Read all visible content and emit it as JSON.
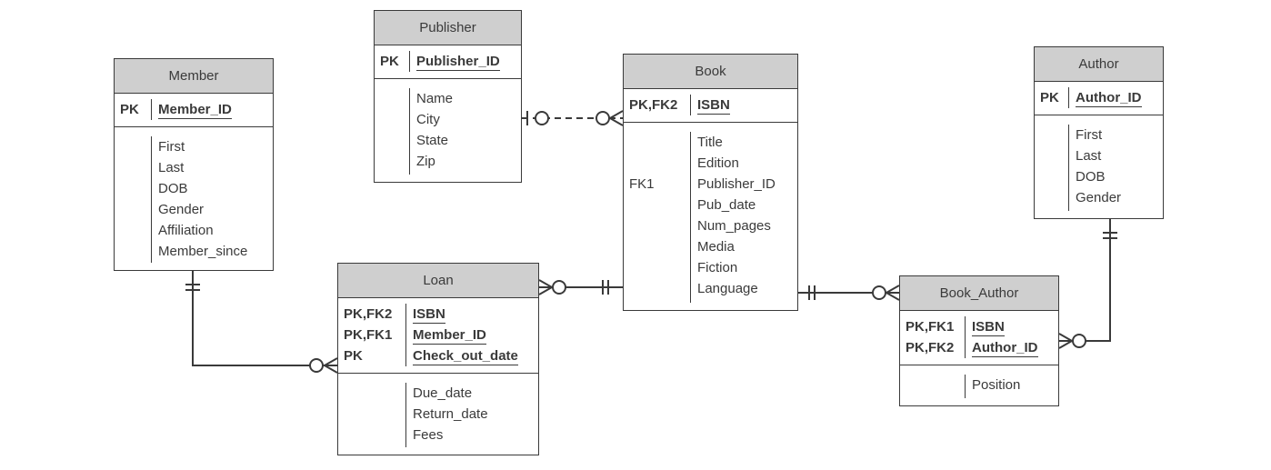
{
  "entities": [
    {
      "id": "publisher",
      "name": "Publisher",
      "pk": [
        {
          "key": "PK",
          "attr": "Publisher_ID"
        }
      ],
      "attrs": [
        {
          "key": "",
          "attr": "Name"
        },
        {
          "key": "",
          "attr": "City"
        },
        {
          "key": "",
          "attr": "State"
        },
        {
          "key": "",
          "attr": "Zip"
        }
      ]
    },
    {
      "id": "member",
      "name": "Member",
      "pk": [
        {
          "key": "PK",
          "attr": "Member_ID"
        }
      ],
      "attrs": [
        {
          "key": "",
          "attr": "First"
        },
        {
          "key": "",
          "attr": "Last"
        },
        {
          "key": "",
          "attr": "DOB"
        },
        {
          "key": "",
          "attr": "Gender"
        },
        {
          "key": "",
          "attr": "Affiliation"
        },
        {
          "key": "",
          "attr": "Member_since"
        }
      ]
    },
    {
      "id": "book",
      "name": "Book",
      "pk": [
        {
          "key": "PK,FK2",
          "attr": "ISBN"
        }
      ],
      "attrs": [
        {
          "key": "",
          "attr": "Title"
        },
        {
          "key": "",
          "attr": "Edition"
        },
        {
          "key": "FK1",
          "attr": "Publisher_ID"
        },
        {
          "key": "",
          "attr": "Pub_date"
        },
        {
          "key": "",
          "attr": "Num_pages"
        },
        {
          "key": "",
          "attr": "Media"
        },
        {
          "key": "",
          "attr": "Fiction"
        },
        {
          "key": "",
          "attr": "Language"
        }
      ]
    },
    {
      "id": "author",
      "name": "Author",
      "pk": [
        {
          "key": "PK",
          "attr": "Author_ID"
        }
      ],
      "attrs": [
        {
          "key": "",
          "attr": "First"
        },
        {
          "key": "",
          "attr": "Last"
        },
        {
          "key": "",
          "attr": "DOB"
        },
        {
          "key": "",
          "attr": "Gender"
        }
      ]
    },
    {
      "id": "loan",
      "name": "Loan",
      "pk": [
        {
          "key": "PK,FK2",
          "attr": "ISBN"
        },
        {
          "key": "PK,FK1",
          "attr": "Member_ID"
        },
        {
          "key": "PK",
          "attr": "Check_out_date"
        }
      ],
      "attrs": [
        {
          "key": "",
          "attr": "Due_date"
        },
        {
          "key": "",
          "attr": "Return_date"
        },
        {
          "key": "",
          "attr": "Fees"
        }
      ]
    },
    {
      "id": "book_author",
      "name": "Book_Author",
      "pk": [
        {
          "key": "PK,FK1",
          "attr": "ISBN"
        },
        {
          "key": "PK,FK2",
          "attr": "Author_ID"
        }
      ],
      "attrs": [
        {
          "key": "",
          "attr": "Position"
        }
      ]
    }
  ],
  "relationships": [
    {
      "from": "Publisher",
      "from_card": "zero-or-one",
      "to": "Book",
      "to_card": "zero-or-many",
      "style": "dashed"
    },
    {
      "from": "Book",
      "from_card": "exactly-one",
      "to": "Loan",
      "to_card": "zero-or-many",
      "style": "solid"
    },
    {
      "from": "Member",
      "from_card": "exactly-one",
      "to": "Loan",
      "to_card": "zero-or-many",
      "style": "solid"
    },
    {
      "from": "Book",
      "from_card": "exactly-one",
      "to": "Book_Author",
      "to_card": "zero-or-many",
      "style": "solid"
    },
    {
      "from": "Author",
      "from_card": "exactly-one",
      "to": "Book_Author",
      "to_card": "zero-or-many",
      "style": "solid"
    }
  ]
}
